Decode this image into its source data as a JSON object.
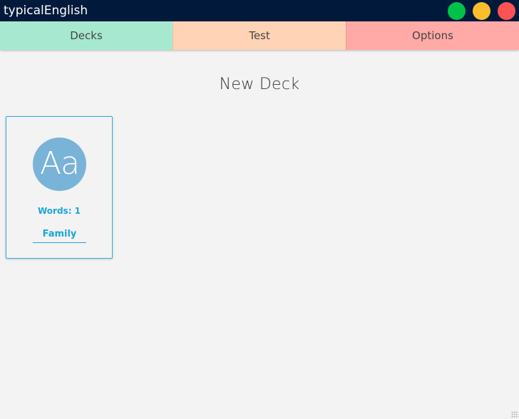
{
  "window": {
    "title": "typicalEnglish",
    "controls": {
      "maximize": {
        "icon": "green-circle-icon",
        "color": "#00c14a"
      },
      "minimize": {
        "icon": "yellow-circle-icon",
        "color": "#fcbd2c"
      },
      "close": {
        "icon": "red-circle-icon",
        "color": "#ff5252"
      }
    }
  },
  "tabs": [
    {
      "label": "Decks",
      "color": "#a7e9d0"
    },
    {
      "label": "Test",
      "color": "#ffd3b6"
    },
    {
      "label": "Options",
      "color": "#ffaaa6"
    }
  ],
  "main": {
    "title": "New Deck",
    "decks": [
      {
        "avatar_text": "Aa",
        "avatar_color": "#79b3d8",
        "words_label": "Words: 1",
        "name": "Family",
        "accent": "#1aa6d8"
      }
    ]
  }
}
